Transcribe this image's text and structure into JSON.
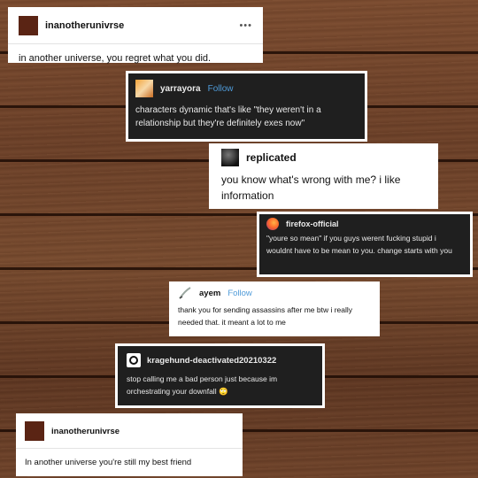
{
  "posts": [
    {
      "username": "inanotherunivrse",
      "text": "in another universe, you regret what you did.",
      "more": "•••",
      "avatar_color": "#5a2414"
    },
    {
      "username": "yarrayora",
      "follow": "Follow",
      "text": "characters dynamic that's like \"they weren't in a relationship but they're definitely exes now\""
    },
    {
      "username": "replicated",
      "text": "you know what's wrong with me? i like information"
    },
    {
      "username": "firefox-official",
      "text": "\"youre so mean\" if you guys werent fucking stupid i wouldnt have to be mean to you. change starts with you"
    },
    {
      "username": "ayem",
      "follow": "Follow",
      "text": "thank you for sending assassins after me btw i really needed that. it meant a lot to me"
    },
    {
      "username": "kragehund-deactivated20210322",
      "text": "stop calling me a bad person just because im orchestrating your downfall",
      "emoji": "🙄"
    },
    {
      "username": "inanotherunivrse",
      "text": "In another universe you're still my best friend",
      "avatar_color": "#5a2414"
    }
  ],
  "colors": {
    "follow": "#4f9bd9",
    "dark_card": "#1f1f1f"
  }
}
